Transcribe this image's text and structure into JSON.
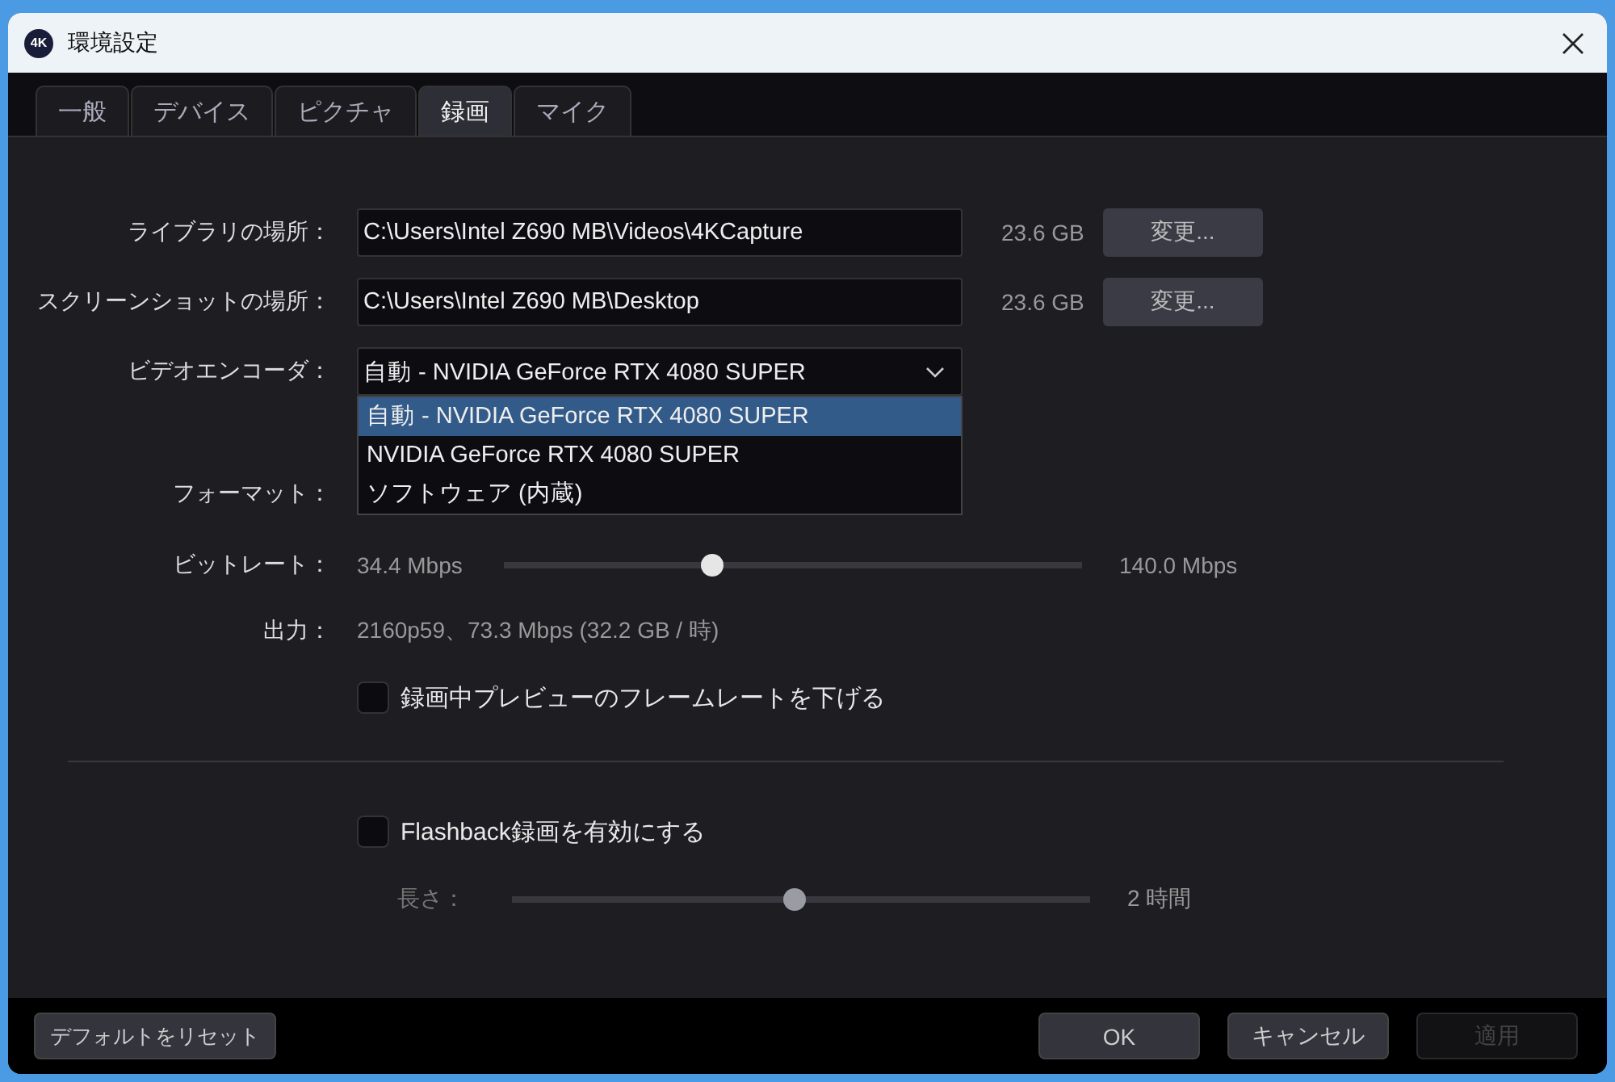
{
  "window": {
    "app_icon_text": "4K",
    "title": "環境設定"
  },
  "tabs": [
    {
      "label": "一般",
      "selected": false
    },
    {
      "label": "デバイス",
      "selected": false
    },
    {
      "label": "ピクチャ",
      "selected": false
    },
    {
      "label": "録画",
      "selected": true
    },
    {
      "label": "マイク",
      "selected": false
    }
  ],
  "paths": [
    {
      "label": "ライブラリの場所：",
      "value": "C:\\Users\\Intel Z690 MB\\Videos\\4KCapture",
      "size": "23.6 GB",
      "button": "変更..."
    },
    {
      "label": "スクリーンショットの場所：",
      "value": "C:\\Users\\Intel Z690 MB\\Desktop",
      "size": "23.6 GB",
      "button": "変更..."
    }
  ],
  "encoder": {
    "label": "ビデオエンコーダ：",
    "value": "自動 - NVIDIA GeForce RTX 4080 SUPER",
    "expanded": true,
    "options": [
      {
        "label": "自動 - NVIDIA GeForce RTX 4080 SUPER",
        "selected": true
      },
      {
        "label": "NVIDIA GeForce RTX 4080 SUPER",
        "selected": false
      },
      {
        "label": "ソフトウェア (内蔵)",
        "selected": false
      }
    ]
  },
  "format": {
    "label": "フォーマット："
  },
  "bitrate": {
    "label": "ビットレート：",
    "reading": "34.4 Mbps",
    "max_reading": "140.0 Mbps",
    "level": 0.36
  },
  "output": {
    "label": "出力：",
    "value": "2160p59、73.3 Mbps (32.2 GB / 時)"
  },
  "reduce_preview": {
    "label": "録画中プレビューのフレームレートを下げる",
    "checked": false
  },
  "flashback": {
    "label": "Flashback録画を有効にする",
    "checked": false
  },
  "length": {
    "label": "長さ：",
    "reading": "2 時間",
    "level": 0.49,
    "disabled": true
  },
  "footer": {
    "reset": "デフォルトをリセット",
    "buttons": [
      {
        "label": "OK",
        "disabled": false
      },
      {
        "label": "キャンセル",
        "disabled": false
      },
      {
        "label": "適用",
        "disabled": true
      }
    ]
  }
}
